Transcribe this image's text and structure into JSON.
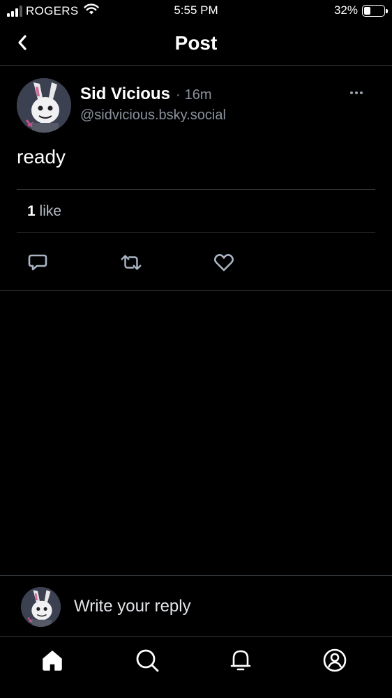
{
  "status_bar": {
    "carrier": "ROGERS",
    "time": "5:55 PM",
    "battery_percent": "32%",
    "battery_level": 0.32
  },
  "header": {
    "title": "Post",
    "back_icon": "chevron-left-icon"
  },
  "post": {
    "author_name": "Sid Vicious",
    "separator": "·",
    "time_ago": "16m",
    "handle": "@sidvicious.bsky.social",
    "text": "ready",
    "likes_count": "1",
    "likes_label": "like",
    "actions": [
      "reply-icon",
      "repost-icon",
      "like-icon"
    ]
  },
  "reply": {
    "placeholder": "Write your reply"
  },
  "tabs": [
    "home-icon",
    "search-icon",
    "notifications-icon",
    "profile-icon"
  ],
  "colors": {
    "background": "#000000",
    "muted_text": "#8b929d",
    "divider": "#2e3338",
    "action_icon": "#aab4c4"
  }
}
